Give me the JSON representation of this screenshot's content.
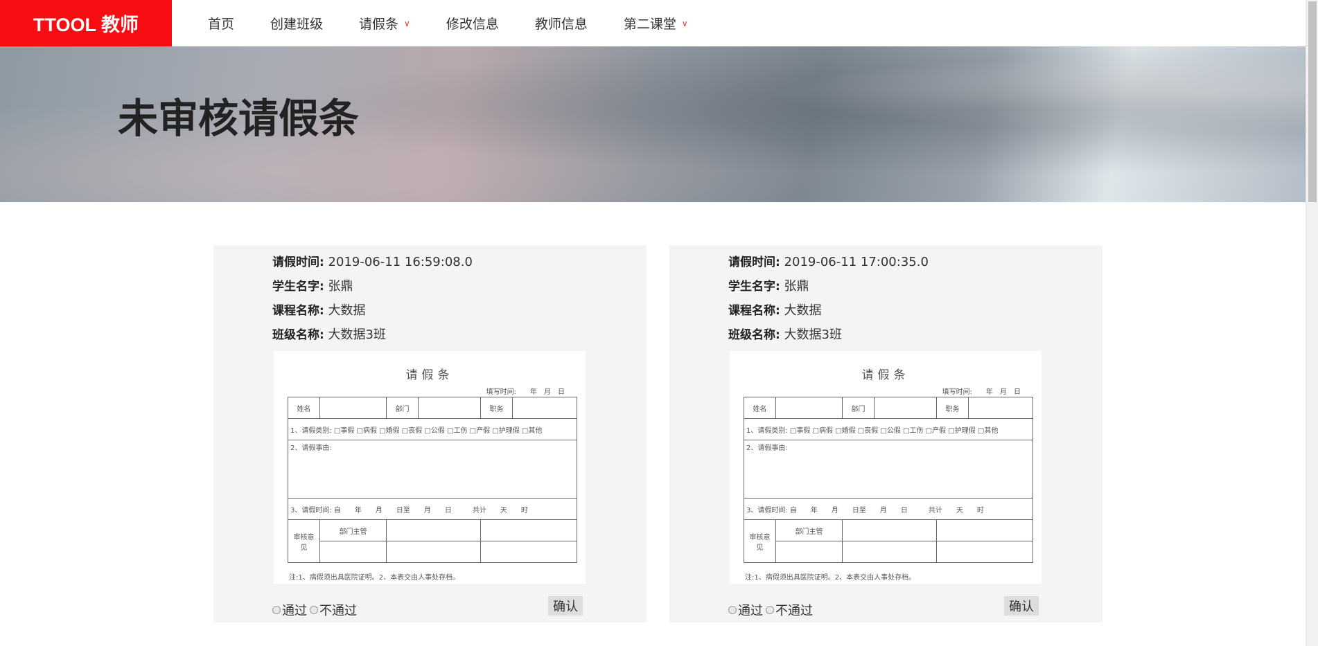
{
  "nav": {
    "logo": "TTOOL 教师",
    "items": [
      {
        "label": "首页"
      },
      {
        "label": "创建班级"
      },
      {
        "label": "请假条",
        "dropdown": true
      },
      {
        "label": "修改信息"
      },
      {
        "label": "教师信息"
      },
      {
        "label": "第二课堂",
        "dropdown": true
      }
    ]
  },
  "banner": {
    "title": "未审核请假条"
  },
  "labels": {
    "time": "请假时间:",
    "student": "学生名字:",
    "course": "课程名称:",
    "class": "班级名称:",
    "pass": "通过",
    "reject": "不通过",
    "confirm": "确认"
  },
  "form": {
    "title": "请假条",
    "date": "填写时间:　　年　月　日",
    "name": "姓名",
    "dept": "部门",
    "position": "职务",
    "type": "1、请假类别: □事假 □病假 □婚假 □丧假 □公假 □工伤 □产假 □护理假 □其他",
    "reason": "2、请假事由:",
    "period": "3、请假时间: 自　　年　　月　　日至　　月　　日　　　共计　　天　　时",
    "review": "审核意见",
    "manager": "部门主管",
    "note": "注:1、病假须出具医院证明。2、本表交由人事处存档。"
  },
  "cards": [
    {
      "time": "2019-06-11 16:59:08.0",
      "student": "张鼎",
      "course": "大数据",
      "class": "大数据3班"
    },
    {
      "time": "2019-06-11 17:00:35.0",
      "student": "张鼎",
      "course": "大数据",
      "class": "大数据3班"
    }
  ]
}
